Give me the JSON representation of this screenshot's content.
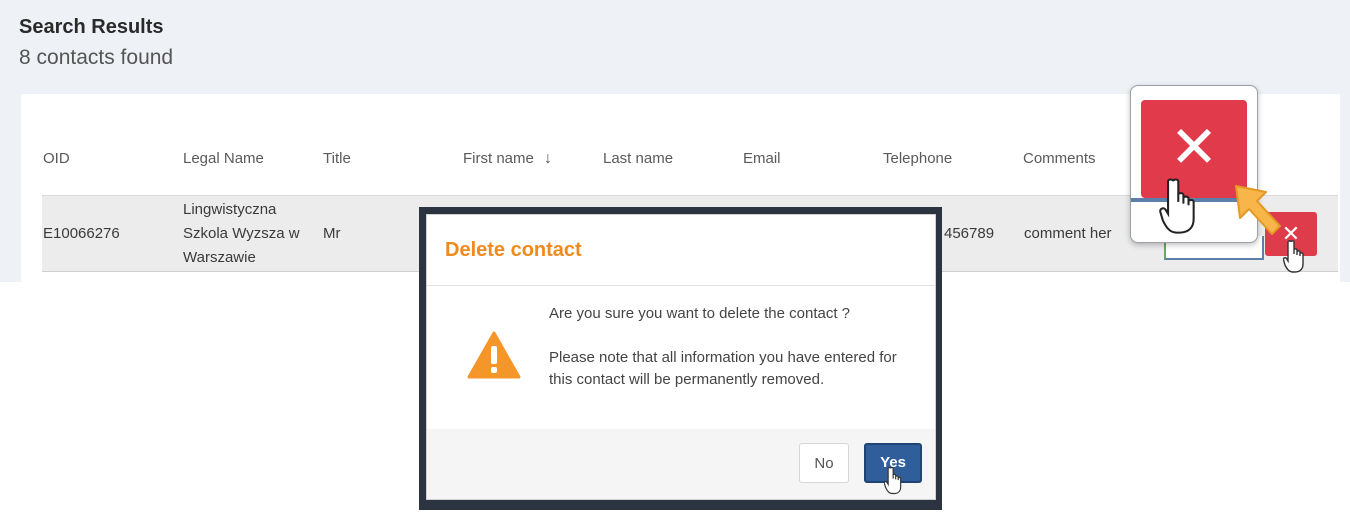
{
  "results": {
    "title": "Search Results",
    "count_text": "8 contacts found"
  },
  "table": {
    "columns": [
      "OID",
      "Legal Name",
      "Title",
      "First name",
      "Last name",
      "Email",
      "Telephone",
      "Comments"
    ],
    "sort_indicator": "↓",
    "rows": [
      {
        "oid": "E10066276",
        "legal_name_lines": [
          "Lingwistyczna",
          "Szkola Wyzsza w",
          "Warszawie"
        ],
        "title": "Mr",
        "telephone_fragment": "456789",
        "comments": "comment her"
      }
    ],
    "delete_glyph": "✕"
  },
  "zoom": {
    "delete_glyph": "✕"
  },
  "modal": {
    "title": "Delete contact",
    "message": "Are you sure you want to delete the contact ?",
    "note": "Please note that all information you have entered for this contact will be permanently removed.",
    "no_label": "No",
    "yes_label": "Yes"
  },
  "colors": {
    "accent_orange": "#f08a1e",
    "delete_red": "#e03a4b",
    "primary_blue": "#2f5e9a"
  }
}
